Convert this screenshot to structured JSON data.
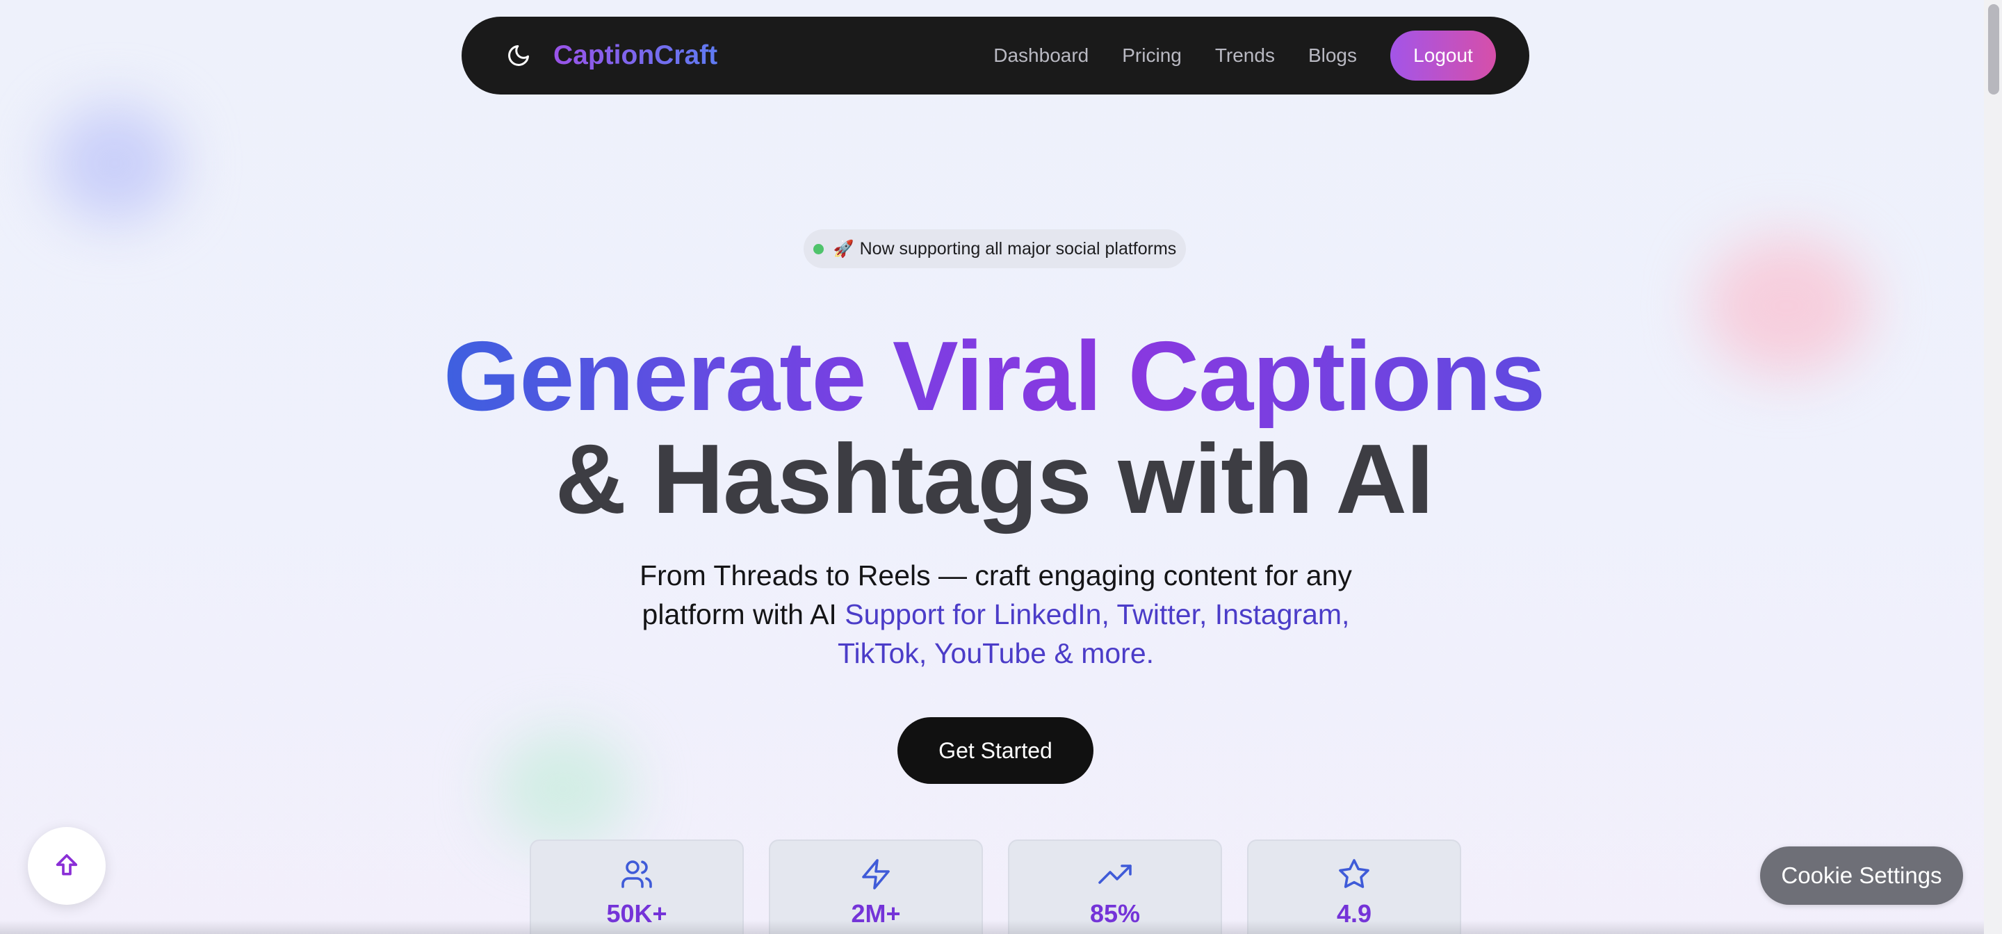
{
  "nav": {
    "brand": "CaptionCraft",
    "links": [
      "Dashboard",
      "Pricing",
      "Trends",
      "Blogs"
    ],
    "logout_label": "Logout",
    "theme_icon": "moon-icon"
  },
  "hero": {
    "badge_text": "Now supporting all major social platforms",
    "badge_emoji": "🚀",
    "headline_gradient": "Generate Viral Captions",
    "headline_dark": "& Hashtags with AI",
    "subtitle_main": "From Threads to Reels — craft engaging content for any platform with AI",
    "subtitle_accent": "Support for LinkedIn, Twitter, Instagram, TikTok, YouTube & more.",
    "cta_label": "Get Started"
  },
  "stats": [
    {
      "icon": "users-icon",
      "value": "50K+"
    },
    {
      "icon": "lightning-icon",
      "value": "2M+"
    },
    {
      "icon": "trending-up-icon",
      "value": "85%"
    },
    {
      "icon": "star-icon",
      "value": "4.9"
    }
  ],
  "floating": {
    "scroll_top_icon": "arrow-up-icon",
    "cookie_label": "Cookie Settings"
  },
  "colors": {
    "brand_gradient_start": "#9a53e8",
    "brand_gradient_end": "#5f7bf2",
    "logout_gradient_start": "#a355e8",
    "logout_gradient_end": "#d64fa9",
    "stat_value": "#7433d8",
    "stat_icon": "#3f5bd8",
    "badge_dot": "#4fc36b"
  }
}
